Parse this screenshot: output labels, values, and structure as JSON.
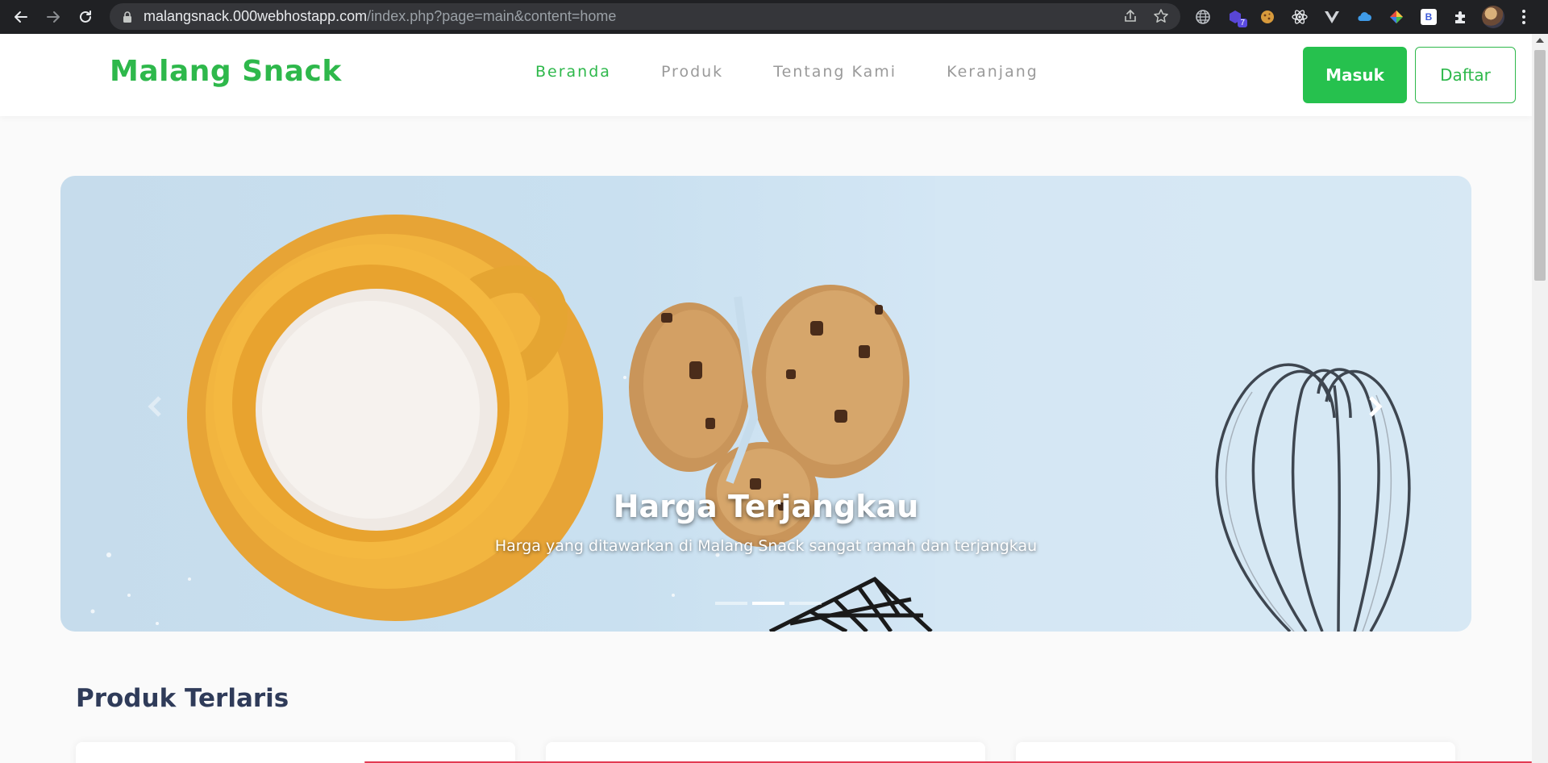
{
  "browser": {
    "url_host": "malangsnack.000webhostapp.com",
    "url_path": "/index.php?page=main&content=home",
    "extension_badge": "7",
    "extension_letter": "B"
  },
  "header": {
    "brand": "Malang Snack",
    "nav": [
      {
        "label": "Beranda",
        "active": true
      },
      {
        "label": "Produk",
        "active": false
      },
      {
        "label": "Tentang Kami",
        "active": false
      },
      {
        "label": "Keranjang",
        "active": false
      }
    ],
    "login_label": "Masuk",
    "register_label": "Daftar"
  },
  "carousel": {
    "title": "Harga Terjangkau",
    "text": "Harga yang ditawarkan di Malang Snack sangat ramah dan terjangkau",
    "slide_count": 3,
    "active_slide": 2
  },
  "section": {
    "title": "Produk Terlaris"
  },
  "colors": {
    "brand_green": "#2eb84b",
    "button_green": "#26c14e",
    "heading": "#2f3b59"
  }
}
